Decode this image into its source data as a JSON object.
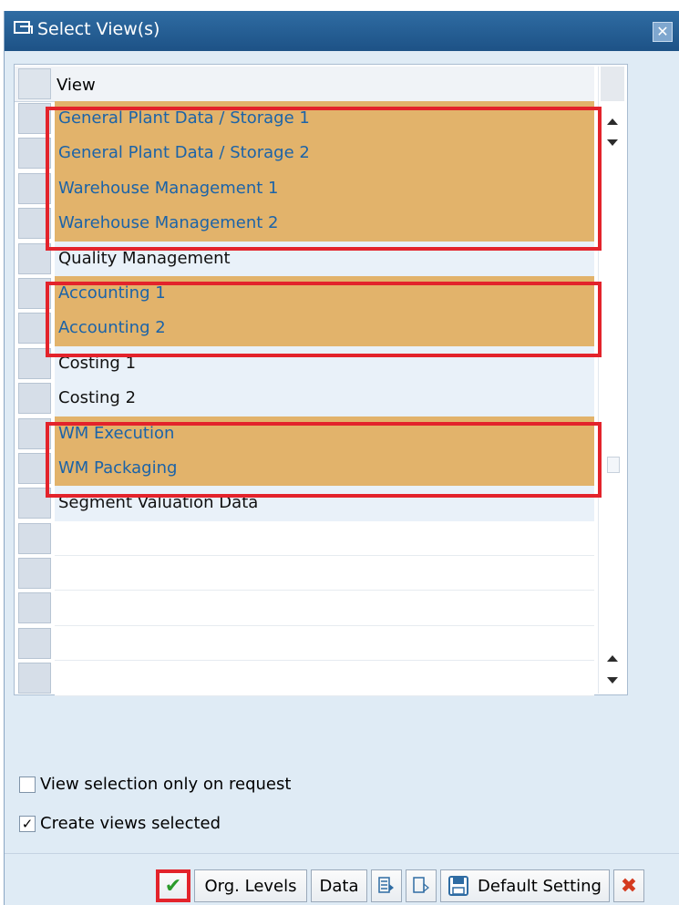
{
  "dialog": {
    "title": "Select View(s)",
    "close_symbol": "✕"
  },
  "table": {
    "column_header": "View",
    "rows": [
      {
        "label": "General Plant Data / Storage 1",
        "selected": true
      },
      {
        "label": "General Plant Data / Storage 2",
        "selected": true
      },
      {
        "label": "Warehouse Management 1",
        "selected": true
      },
      {
        "label": "Warehouse Management 2",
        "selected": true
      },
      {
        "label": "Quality Management",
        "selected": false
      },
      {
        "label": "Accounting 1",
        "selected": true
      },
      {
        "label": "Accounting 2",
        "selected": true
      },
      {
        "label": "Costing 1",
        "selected": false
      },
      {
        "label": "Costing 2",
        "selected": false
      },
      {
        "label": "WM Execution",
        "selected": true
      },
      {
        "label": "WM Packaging",
        "selected": true
      },
      {
        "label": "Segment Valuation Data",
        "selected": false
      }
    ]
  },
  "options": {
    "view_selection_only_on_request": {
      "label": "View selection only on request",
      "checked": false
    },
    "create_views_selected": {
      "label": "Create views selected",
      "checked": true,
      "mark": "✓"
    }
  },
  "buttons": {
    "ok_symbol": "✔",
    "org_levels": "Org. Levels",
    "data": "Data",
    "select_all_icon": "select-all-icon",
    "deselect_all_icon": "deselect-all-icon",
    "save_icon": "save-icon",
    "default_setting": "Default Setting",
    "cancel_symbol": "✖"
  },
  "colors": {
    "title_bar": "#1d5286",
    "selected_row": "#e2b36b",
    "selected_text": "#1b63a8",
    "highlight_border": "#e3232b"
  }
}
